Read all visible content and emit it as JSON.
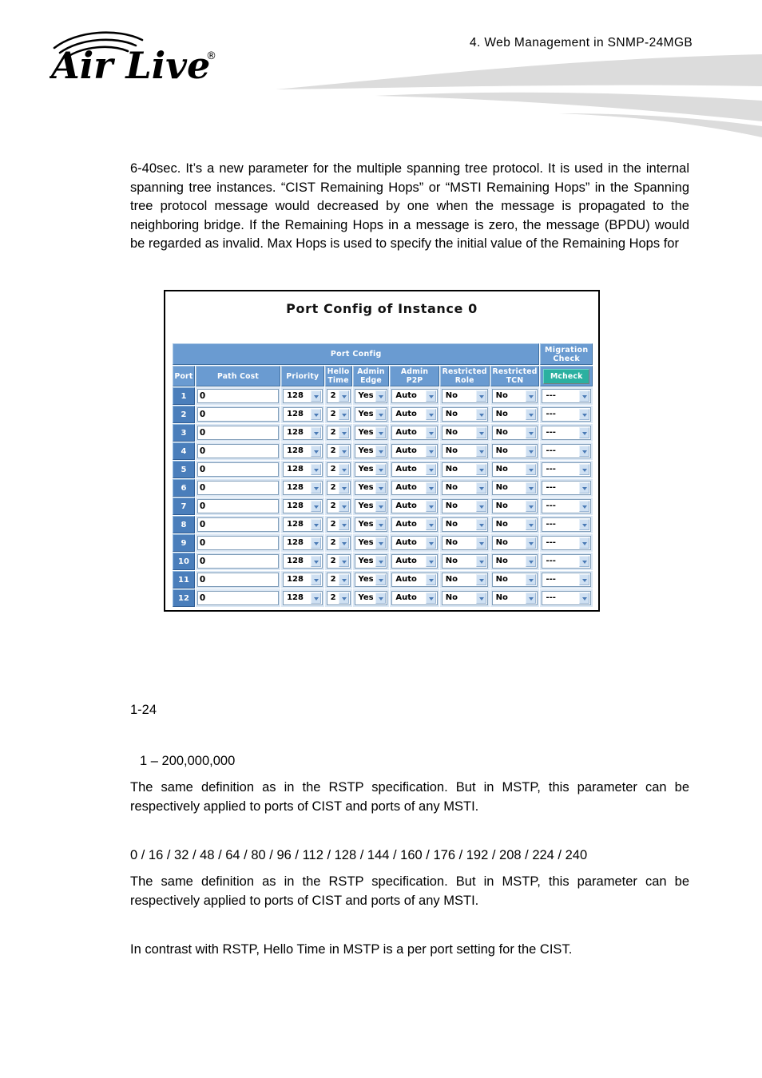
{
  "header": {
    "title": "4.  Web Management  in  SNMP-24MGB",
    "logo_text": "Air Live",
    "logo_trademark": "®",
    "swoosh_color": "#dcdcdc"
  },
  "body_text": {
    "intro_paragraph": "6-40sec. It’s a new parameter for the multiple spanning tree protocol. It is used in the internal spanning tree instances. “CIST Remaining Hops” or “MSTI Remaining Hops” in the Spanning tree protocol message would decreased by one when the message is propagated to the neighboring bridge. If the Remaining Hops in a message is zero, the message (BPDU) would be regarded as invalid. Max Hops is used to specify the initial value of the Remaining Hops for",
    "page_number": "1-24",
    "range_line": "1 – 200,000,000",
    "desc_paragraph_1": "The same definition as in the RSTP specification. But in MSTP, this parameter can be respectively applied to ports of CIST and ports of   any MSTI.",
    "values_line": "0 / 16 / 32 / 48 / 64 / 80 / 96 / 112 / 128 / 144 / 160 / 176 / 192 / 208 / 224 / 240",
    "desc_paragraph_2": "The same definition as in the RSTP specification. But in MSTP, this parameter can be respectively applied to ports of CIST and ports of any MSTI.",
    "hello_note": "In contrast with RSTP, Hello Time in MSTP is a per port setting for the CIST."
  },
  "screenshot": {
    "panel_title": "Port Config of Instance 0",
    "group_headers": [
      {
        "label": "Port Config",
        "colspan": 8
      },
      {
        "label": "Migration\nCheck",
        "colspan": 1
      }
    ],
    "group_header_1": "Port Config",
    "group_header_2_line1": "Migration",
    "group_header_2_line2": "Check",
    "columns": [
      {
        "line1": "Port",
        "line2": ""
      },
      {
        "line1": "Path Cost",
        "line2": ""
      },
      {
        "line1": "Priority",
        "line2": ""
      },
      {
        "line1": "Hello",
        "line2": "Time"
      },
      {
        "line1": "Admin",
        "line2": "Edge"
      },
      {
        "line1": "Admin",
        "line2": "P2P"
      },
      {
        "line1": "Restricted",
        "line2": "Role"
      },
      {
        "line1": "Restricted",
        "line2": "TCN"
      }
    ],
    "mcheck_button_label": "Mcheck",
    "colors": {
      "header_blue": "#6a9bd1",
      "port_cell_blue": "#4a7ebb",
      "row_blue": "#dbe7f4",
      "mcheck_teal": "#2bb0a0",
      "panel_border": "#000000"
    },
    "rows": [
      {
        "port": "1",
        "path_cost": "0",
        "priority": "128",
        "hello_time": "2",
        "admin_edge": "Yes",
        "admin_p2p": "Auto",
        "restricted_role": "No",
        "restricted_tcn": "No",
        "mcheck": "---"
      },
      {
        "port": "2",
        "path_cost": "0",
        "priority": "128",
        "hello_time": "2",
        "admin_edge": "Yes",
        "admin_p2p": "Auto",
        "restricted_role": "No",
        "restricted_tcn": "No",
        "mcheck": "---"
      },
      {
        "port": "3",
        "path_cost": "0",
        "priority": "128",
        "hello_time": "2",
        "admin_edge": "Yes",
        "admin_p2p": "Auto",
        "restricted_role": "No",
        "restricted_tcn": "No",
        "mcheck": "---"
      },
      {
        "port": "4",
        "path_cost": "0",
        "priority": "128",
        "hello_time": "2",
        "admin_edge": "Yes",
        "admin_p2p": "Auto",
        "restricted_role": "No",
        "restricted_tcn": "No",
        "mcheck": "---"
      },
      {
        "port": "5",
        "path_cost": "0",
        "priority": "128",
        "hello_time": "2",
        "admin_edge": "Yes",
        "admin_p2p": "Auto",
        "restricted_role": "No",
        "restricted_tcn": "No",
        "mcheck": "---"
      },
      {
        "port": "6",
        "path_cost": "0",
        "priority": "128",
        "hello_time": "2",
        "admin_edge": "Yes",
        "admin_p2p": "Auto",
        "restricted_role": "No",
        "restricted_tcn": "No",
        "mcheck": "---"
      },
      {
        "port": "7",
        "path_cost": "0",
        "priority": "128",
        "hello_time": "2",
        "admin_edge": "Yes",
        "admin_p2p": "Auto",
        "restricted_role": "No",
        "restricted_tcn": "No",
        "mcheck": "---"
      },
      {
        "port": "8",
        "path_cost": "0",
        "priority": "128",
        "hello_time": "2",
        "admin_edge": "Yes",
        "admin_p2p": "Auto",
        "restricted_role": "No",
        "restricted_tcn": "No",
        "mcheck": "---"
      },
      {
        "port": "9",
        "path_cost": "0",
        "priority": "128",
        "hello_time": "2",
        "admin_edge": "Yes",
        "admin_p2p": "Auto",
        "restricted_role": "No",
        "restricted_tcn": "No",
        "mcheck": "---"
      },
      {
        "port": "10",
        "path_cost": "0",
        "priority": "128",
        "hello_time": "2",
        "admin_edge": "Yes",
        "admin_p2p": "Auto",
        "restricted_role": "No",
        "restricted_tcn": "No",
        "mcheck": "---"
      },
      {
        "port": "11",
        "path_cost": "0",
        "priority": "128",
        "hello_time": "2",
        "admin_edge": "Yes",
        "admin_p2p": "Auto",
        "restricted_role": "No",
        "restricted_tcn": "No",
        "mcheck": "---"
      },
      {
        "port": "12",
        "path_cost": "0",
        "priority": "128",
        "hello_time": "2",
        "admin_edge": "Yes",
        "admin_p2p": "Auto",
        "restricted_role": "No",
        "restricted_tcn": "No",
        "mcheck": "---"
      }
    ]
  }
}
